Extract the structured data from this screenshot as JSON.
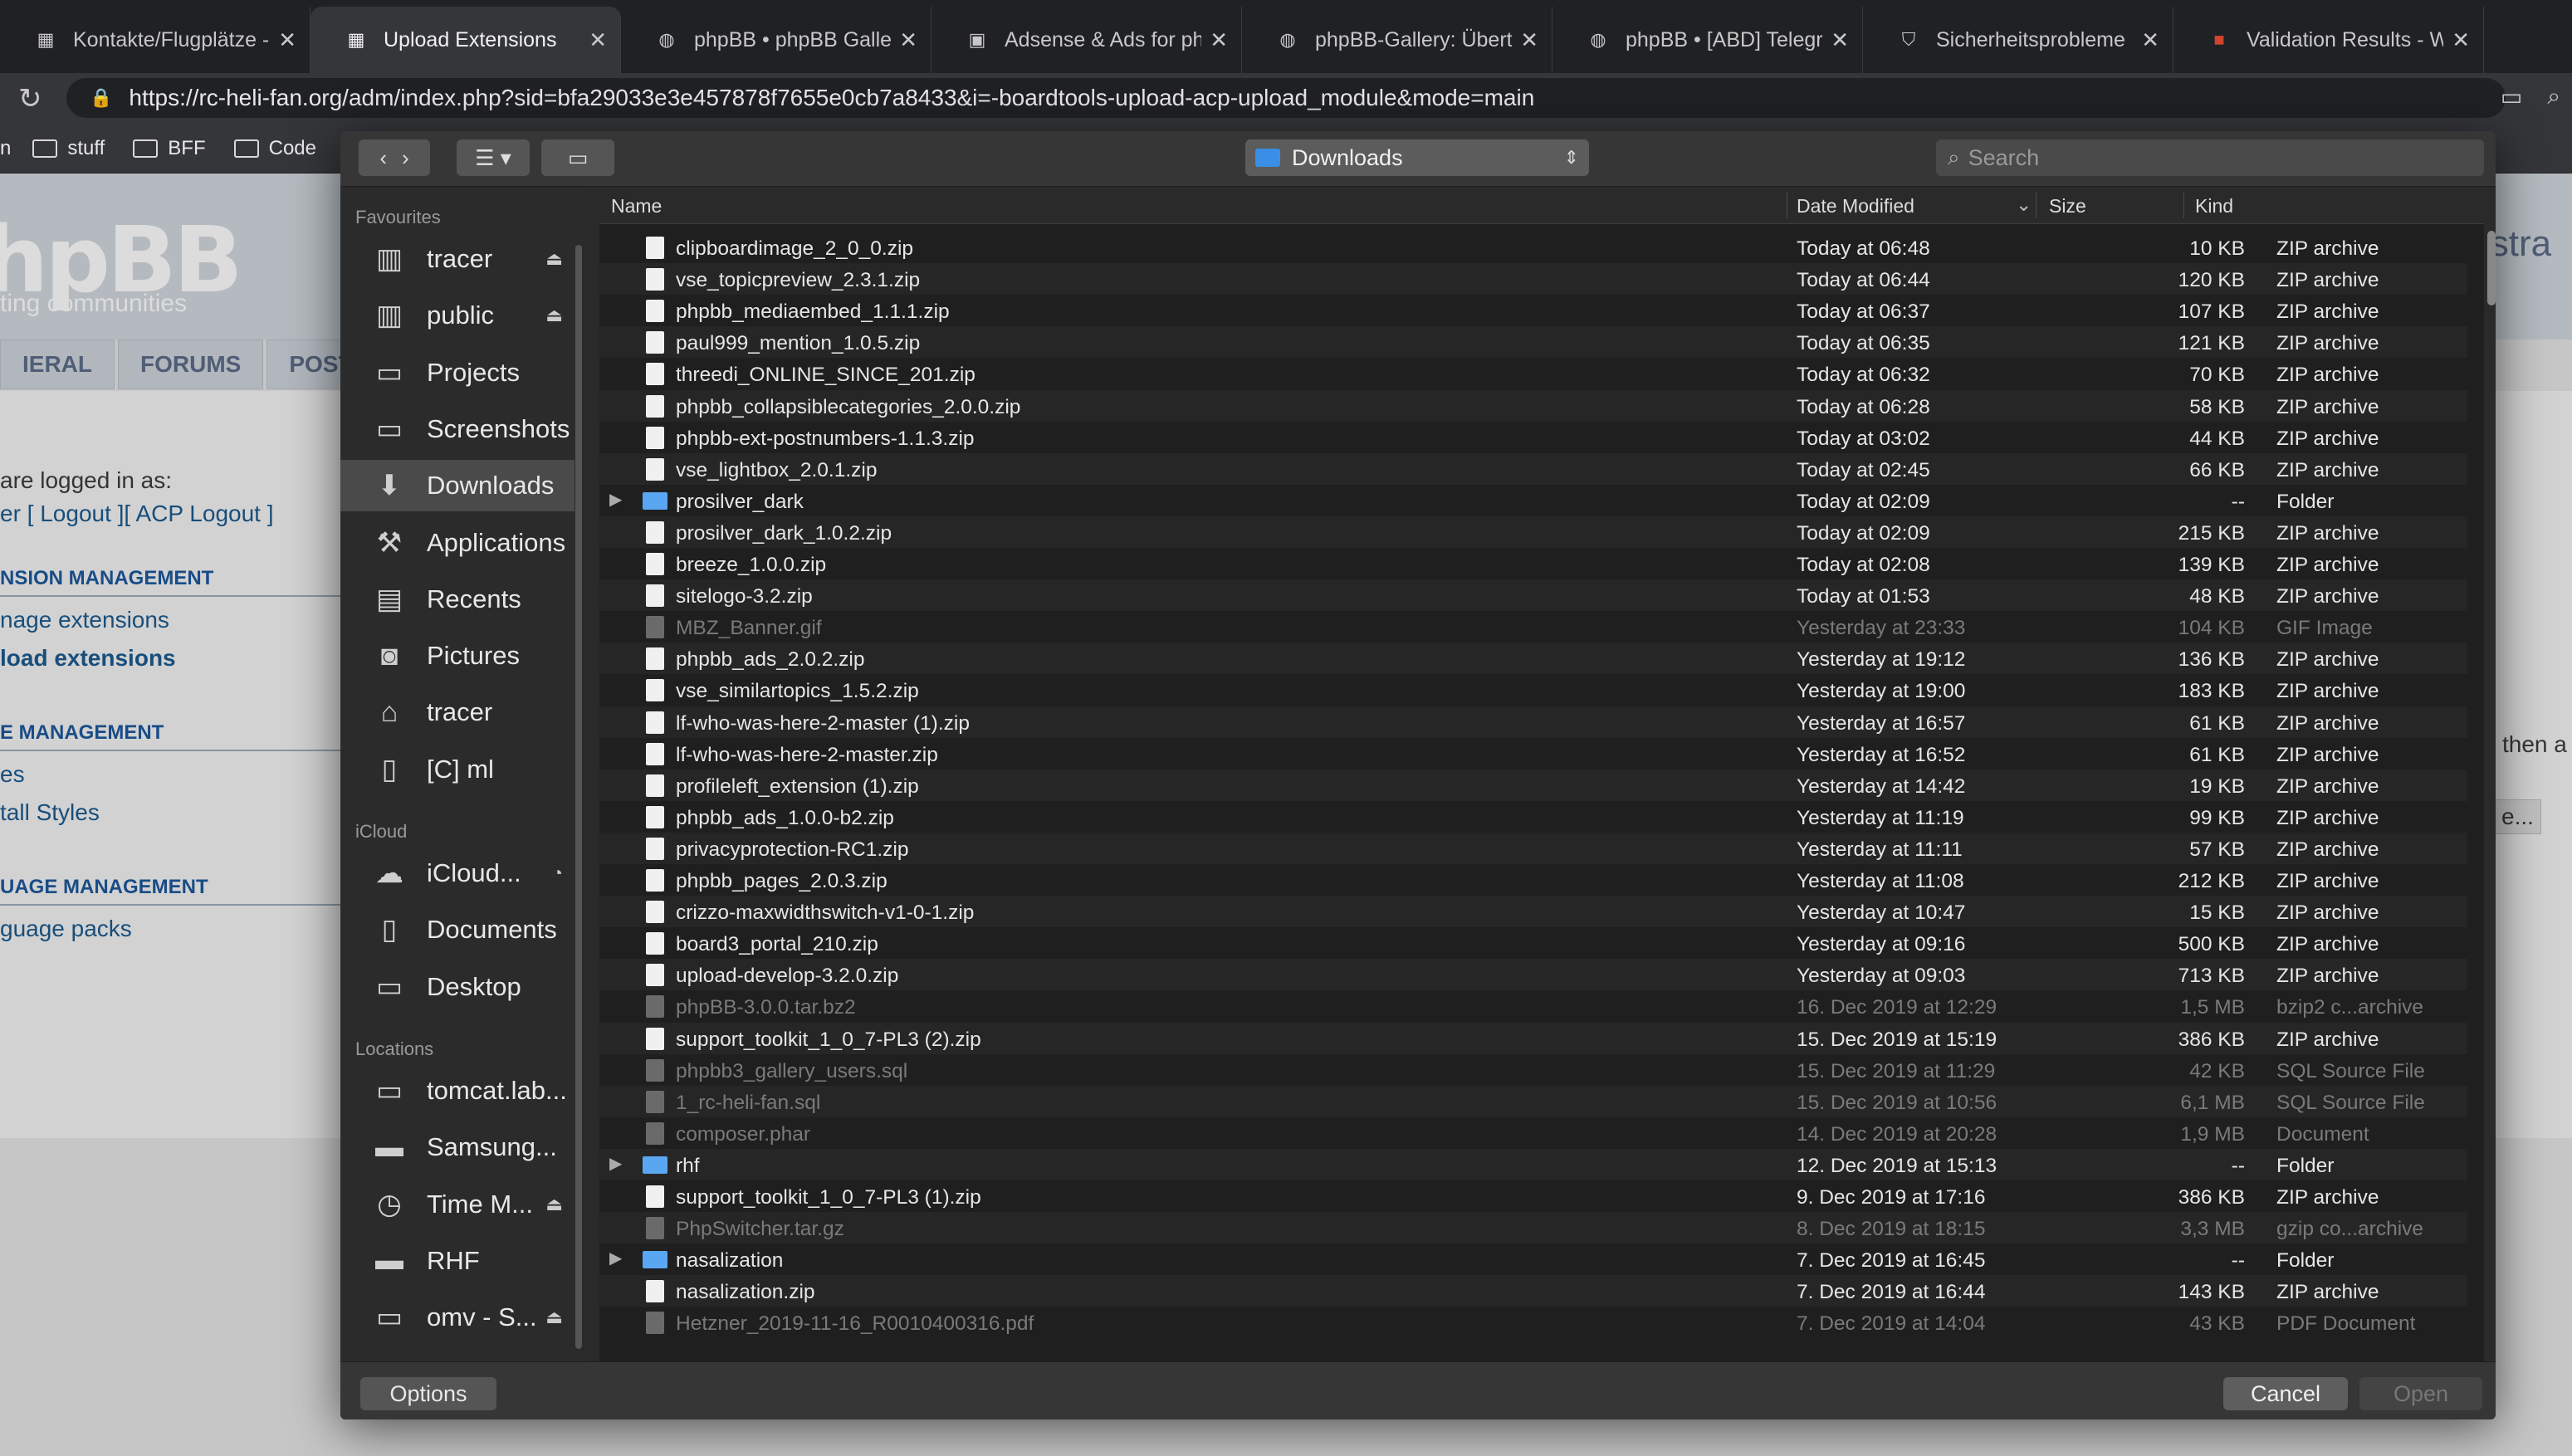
{
  "browser": {
    "tabs": [
      {
        "title": "Kontakte/Flugplätze -",
        "icon": "phpbb-icon",
        "active": false
      },
      {
        "title": "Upload Extensions",
        "icon": "phpbb-icon",
        "active": true
      },
      {
        "title": "phpBB • phpBB Galler",
        "icon": "phpbb-user-icon",
        "active": false
      },
      {
        "title": "Adsense & Ads for php",
        "icon": "ads-icon",
        "active": false
      },
      {
        "title": "phpBB-Gallery: Übertr",
        "icon": "phpbb-user-icon",
        "active": false
      },
      {
        "title": "phpBB • [ABD] Telegra",
        "icon": "phpbb-user-icon",
        "active": false
      },
      {
        "title": "Sicherheitsprobleme",
        "icon": "security-icon",
        "active": false
      },
      {
        "title": "Validation Results - W",
        "icon": "w3c-icon",
        "active": false
      }
    ],
    "url": "https://rc-heli-fan.org/adm/index.php?sid=bfa29033e3e457878f7655e0cb7a8433&i=-boardtools-upload-acp-upload_module&mode=main",
    "bookmarks": [
      "n",
      "stuff",
      "BFF",
      "Code"
    ]
  },
  "page": {
    "logo": "hpBB",
    "logo_sub": "ting communities",
    "nav_tabs": [
      "IERAL",
      "FORUMS",
      "POSTIN"
    ],
    "logged_in": "are logged in as:",
    "logout_links": "er [ Logout ][ ACP Logout ]",
    "sections": [
      {
        "title": "NSION MANAGEMENT",
        "links": [
          "nage extensions",
          "load extensions"
        ]
      },
      {
        "title": "E MANAGEMENT",
        "links": [
          "es",
          "tall Styles"
        ]
      },
      {
        "title": "UAGE MANAGEMENT",
        "links": [
          "guage packs"
        ]
      }
    ],
    "right_title": "istra",
    "right_text": "then a",
    "right_button": "e..."
  },
  "dialog": {
    "location": "Downloads",
    "search_placeholder": "Search",
    "sidebar": {
      "favourites_label": "Favourites",
      "favourites": [
        {
          "label": "tracer",
          "icon": "network-drive-icon",
          "eject": true
        },
        {
          "label": "public",
          "icon": "network-drive-icon",
          "eject": true
        },
        {
          "label": "Projects",
          "icon": "folder-icon",
          "eject": false
        },
        {
          "label": "Screenshots",
          "icon": "folder-icon",
          "eject": false
        },
        {
          "label": "Downloads",
          "icon": "downloads-icon",
          "eject": false,
          "selected": true
        },
        {
          "label": "Applications",
          "icon": "applications-icon",
          "eject": false
        },
        {
          "label": "Recents",
          "icon": "recents-icon",
          "eject": false
        },
        {
          "label": "Pictures",
          "icon": "camera-icon",
          "eject": false
        },
        {
          "label": "tracer",
          "icon": "home-icon",
          "eject": false
        },
        {
          "label": "[C] ml",
          "icon": "document-icon",
          "eject": false
        }
      ],
      "icloud_label": "iCloud",
      "icloud": [
        {
          "label": "iCloud...",
          "icon": "cloud-icon",
          "progress": true
        },
        {
          "label": "Documents",
          "icon": "documents-icon"
        },
        {
          "label": "Desktop",
          "icon": "desktop-icon"
        }
      ],
      "locations_label": "Locations",
      "locations": [
        {
          "label": "tomcat.lab...",
          "icon": "computer-icon",
          "eject": false
        },
        {
          "label": "Samsung...",
          "icon": "disk-icon",
          "eject": false
        },
        {
          "label": "Time M...",
          "icon": "time-machine-icon",
          "eject": true
        },
        {
          "label": "RHF",
          "icon": "disk-icon",
          "eject": false
        },
        {
          "label": "omv - S...",
          "icon": "computer-icon",
          "eject": true
        }
      ]
    },
    "columns": {
      "name": "Name",
      "date": "Date Modified",
      "size": "Size",
      "kind": "Kind"
    },
    "files": [
      {
        "name": "clipboardimage_2_0_0.zip",
        "date": "Today at 06:48",
        "size": "10 KB",
        "kind": "ZIP archive",
        "type": "file",
        "dim": false
      },
      {
        "name": "vse_topicpreview_2.3.1.zip",
        "date": "Today at 06:44",
        "size": "120 KB",
        "kind": "ZIP archive",
        "type": "file",
        "dim": false
      },
      {
        "name": "phpbb_mediaembed_1.1.1.zip",
        "date": "Today at 06:37",
        "size": "107 KB",
        "kind": "ZIP archive",
        "type": "file",
        "dim": false
      },
      {
        "name": "paul999_mention_1.0.5.zip",
        "date": "Today at 06:35",
        "size": "121 KB",
        "kind": "ZIP archive",
        "type": "file",
        "dim": false
      },
      {
        "name": "threedi_ONLINE_SINCE_201.zip",
        "date": "Today at 06:32",
        "size": "70 KB",
        "kind": "ZIP archive",
        "type": "file",
        "dim": false
      },
      {
        "name": "phpbb_collapsiblecategories_2.0.0.zip",
        "date": "Today at 06:28",
        "size": "58 KB",
        "kind": "ZIP archive",
        "type": "file",
        "dim": false
      },
      {
        "name": "phpbb-ext-postnumbers-1.1.3.zip",
        "date": "Today at 03:02",
        "size": "44 KB",
        "kind": "ZIP archive",
        "type": "file",
        "dim": false
      },
      {
        "name": "vse_lightbox_2.0.1.zip",
        "date": "Today at 02:45",
        "size": "66 KB",
        "kind": "ZIP archive",
        "type": "file",
        "dim": false
      },
      {
        "name": "prosilver_dark",
        "date": "Today at 02:09",
        "size": "--",
        "kind": "Folder",
        "type": "folder",
        "dim": false
      },
      {
        "name": "prosilver_dark_1.0.2.zip",
        "date": "Today at 02:09",
        "size": "215 KB",
        "kind": "ZIP archive",
        "type": "file",
        "dim": false
      },
      {
        "name": "breeze_1.0.0.zip",
        "date": "Today at 02:08",
        "size": "139 KB",
        "kind": "ZIP archive",
        "type": "file",
        "dim": false
      },
      {
        "name": "sitelogo-3.2.zip",
        "date": "Today at 01:53",
        "size": "48 KB",
        "kind": "ZIP archive",
        "type": "file",
        "dim": false
      },
      {
        "name": "MBZ_Banner.gif",
        "date": "Yesterday at 23:33",
        "size": "104 KB",
        "kind": "GIF Image",
        "type": "file",
        "dim": true
      },
      {
        "name": "phpbb_ads_2.0.2.zip",
        "date": "Yesterday at 19:12",
        "size": "136 KB",
        "kind": "ZIP archive",
        "type": "file",
        "dim": false
      },
      {
        "name": "vse_similartopics_1.5.2.zip",
        "date": "Yesterday at 19:00",
        "size": "183 KB",
        "kind": "ZIP archive",
        "type": "file",
        "dim": false
      },
      {
        "name": "lf-who-was-here-2-master (1).zip",
        "date": "Yesterday at 16:57",
        "size": "61 KB",
        "kind": "ZIP archive",
        "type": "file",
        "dim": false
      },
      {
        "name": "lf-who-was-here-2-master.zip",
        "date": "Yesterday at 16:52",
        "size": "61 KB",
        "kind": "ZIP archive",
        "type": "file",
        "dim": false
      },
      {
        "name": "profileleft_extension (1).zip",
        "date": "Yesterday at 14:42",
        "size": "19 KB",
        "kind": "ZIP archive",
        "type": "file",
        "dim": false
      },
      {
        "name": "phpbb_ads_1.0.0-b2.zip",
        "date": "Yesterday at 11:19",
        "size": "99 KB",
        "kind": "ZIP archive",
        "type": "file",
        "dim": false
      },
      {
        "name": "privacyprotection-RC1.zip",
        "date": "Yesterday at 11:11",
        "size": "57 KB",
        "kind": "ZIP archive",
        "type": "file",
        "dim": false
      },
      {
        "name": "phpbb_pages_2.0.3.zip",
        "date": "Yesterday at 11:08",
        "size": "212 KB",
        "kind": "ZIP archive",
        "type": "file",
        "dim": false
      },
      {
        "name": "crizzo-maxwidthswitch-v1-0-1.zip",
        "date": "Yesterday at 10:47",
        "size": "15 KB",
        "kind": "ZIP archive",
        "type": "file",
        "dim": false
      },
      {
        "name": "board3_portal_210.zip",
        "date": "Yesterday at 09:16",
        "size": "500 KB",
        "kind": "ZIP archive",
        "type": "file",
        "dim": false
      },
      {
        "name": "upload-develop-3.2.0.zip",
        "date": "Yesterday at 09:03",
        "size": "713 KB",
        "kind": "ZIP archive",
        "type": "file",
        "dim": false
      },
      {
        "name": "phpBB-3.0.0.tar.bz2",
        "date": "16. Dec 2019 at 12:29",
        "size": "1,5 MB",
        "kind": "bzip2 c...archive",
        "type": "file",
        "dim": true
      },
      {
        "name": "support_toolkit_1_0_7-PL3 (2).zip",
        "date": "15. Dec 2019 at 15:19",
        "size": "386 KB",
        "kind": "ZIP archive",
        "type": "file",
        "dim": false
      },
      {
        "name": "phpbb3_gallery_users.sql",
        "date": "15. Dec 2019 at 11:29",
        "size": "42 KB",
        "kind": "SQL Source File",
        "type": "file",
        "dim": true
      },
      {
        "name": "1_rc-heli-fan.sql",
        "date": "15. Dec 2019 at 10:56",
        "size": "6,1 MB",
        "kind": "SQL Source File",
        "type": "file",
        "dim": true
      },
      {
        "name": "composer.phar",
        "date": "14. Dec 2019 at 20:28",
        "size": "1,9 MB",
        "kind": "Document",
        "type": "file",
        "dim": true
      },
      {
        "name": "rhf",
        "date": "12. Dec 2019 at 15:13",
        "size": "--",
        "kind": "Folder",
        "type": "folder",
        "dim": false
      },
      {
        "name": "support_toolkit_1_0_7-PL3 (1).zip",
        "date": "9. Dec 2019 at 17:16",
        "size": "386 KB",
        "kind": "ZIP archive",
        "type": "file",
        "dim": false
      },
      {
        "name": "PhpSwitcher.tar.gz",
        "date": "8. Dec 2019 at 18:15",
        "size": "3,3 MB",
        "kind": "gzip co...archive",
        "type": "file",
        "dim": true
      },
      {
        "name": "nasalization",
        "date": "7. Dec 2019 at 16:45",
        "size": "--",
        "kind": "Folder",
        "type": "folder",
        "dim": false
      },
      {
        "name": "nasalization.zip",
        "date": "7. Dec 2019 at 16:44",
        "size": "143 KB",
        "kind": "ZIP archive",
        "type": "file",
        "dim": false
      },
      {
        "name": "Hetzner_2019-11-16_R0010400316.pdf",
        "date": "7. Dec 2019 at 14:04",
        "size": "43 KB",
        "kind": "PDF Document",
        "type": "file",
        "dim": true
      }
    ],
    "buttons": {
      "options": "Options",
      "cancel": "Cancel",
      "open": "Open"
    }
  }
}
